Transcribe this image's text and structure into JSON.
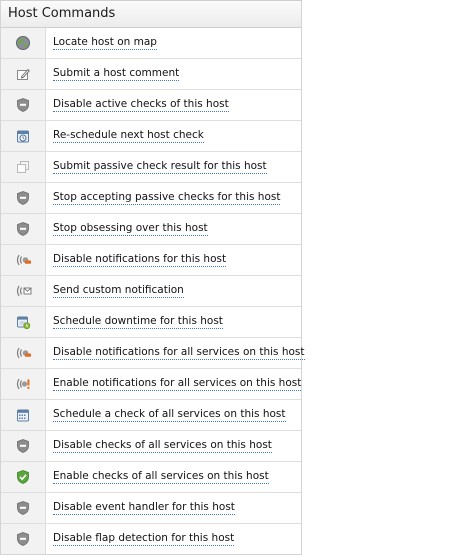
{
  "panel": {
    "title": "Host Commands"
  },
  "colors": {
    "link_underline": "#3b7abf",
    "header_bg": "#ececec",
    "icon_cell_bg": "#f2f2f2"
  },
  "commands": [
    {
      "label": "Locate host on map",
      "icon": "globe-icon"
    },
    {
      "label": "Submit a host comment",
      "icon": "comment-icon"
    },
    {
      "label": "Disable active checks of this host",
      "icon": "shield-icon"
    },
    {
      "label": "Re-schedule next host check",
      "icon": "reschedule-icon"
    },
    {
      "label": "Submit passive check result for this host",
      "icon": "passive-result-icon"
    },
    {
      "label": "Stop accepting passive checks for this host",
      "icon": "shield-icon"
    },
    {
      "label": "Stop obsessing over this host",
      "icon": "shield-icon"
    },
    {
      "label": "Disable notifications for this host",
      "icon": "notifications-disable-icon"
    },
    {
      "label": "Send custom notification",
      "icon": "custom-notification-icon"
    },
    {
      "label": "Schedule downtime for this host",
      "icon": "downtime-icon"
    },
    {
      "label": "Disable notifications for all services on this host",
      "icon": "notifications-disable-icon"
    },
    {
      "label": "Enable notifications for all services on this host",
      "icon": "notifications-enable-icon"
    },
    {
      "label": "Schedule a check of all services on this host",
      "icon": "calendar-icon"
    },
    {
      "label": "Disable checks of all services on this host",
      "icon": "shield-icon"
    },
    {
      "label": "Enable checks of all services on this host",
      "icon": "shield-check-icon"
    },
    {
      "label": "Disable event handler for this host",
      "icon": "shield-icon"
    },
    {
      "label": "Disable flap detection for this host",
      "icon": "shield-icon"
    }
  ]
}
